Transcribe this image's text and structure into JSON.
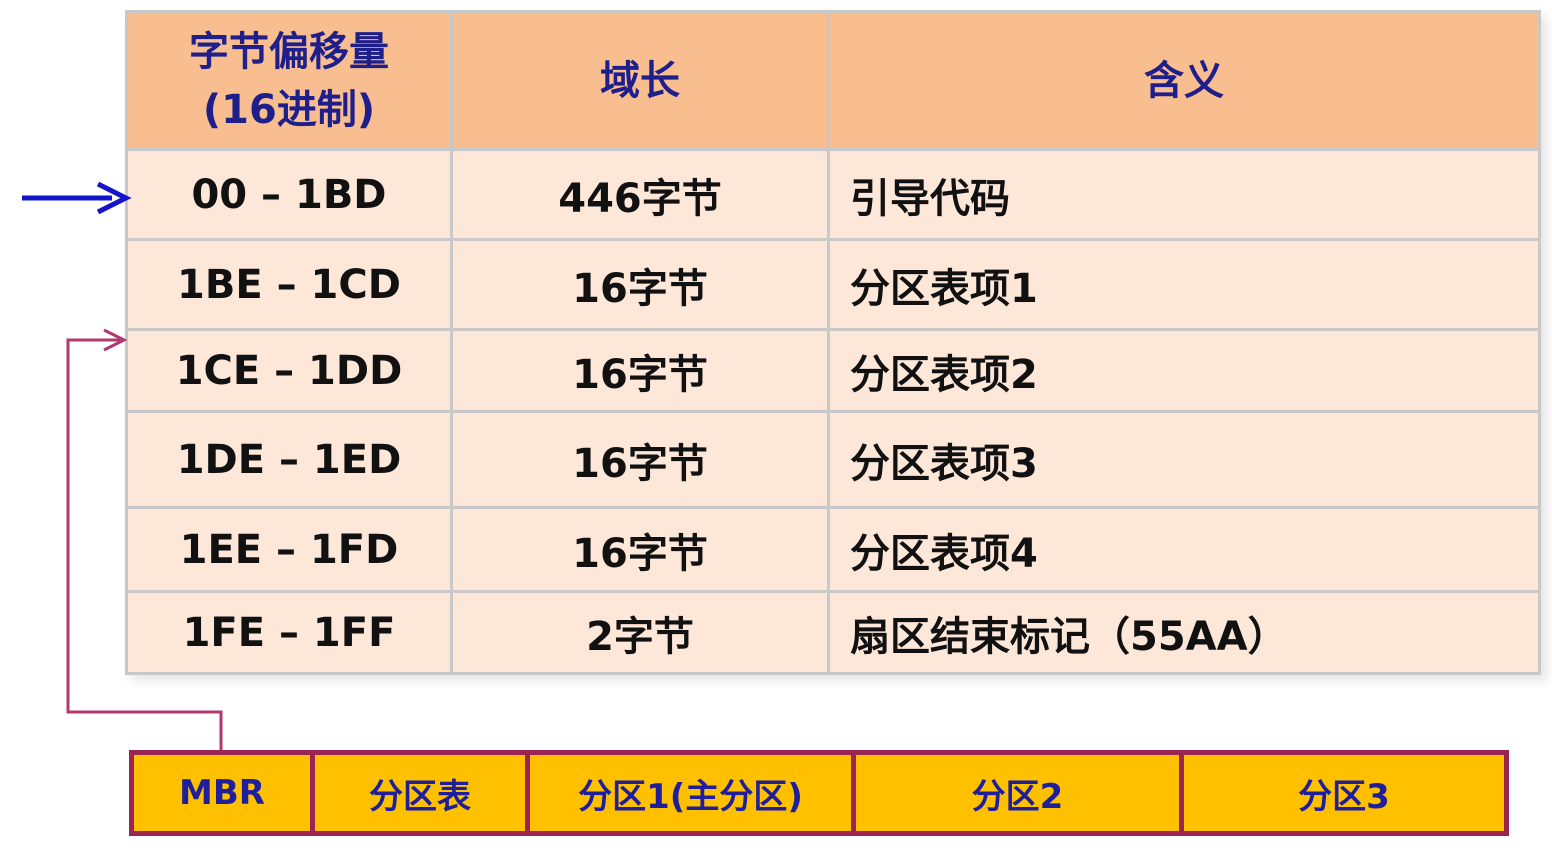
{
  "table": {
    "headers": [
      "字节偏移量\n(16进制)",
      "域长",
      "含义"
    ],
    "rows": [
      {
        "offset": "00 – 1BD",
        "length": "446字节",
        "meaning": "引导代码"
      },
      {
        "offset": "1BE – 1CD",
        "length": "16字节",
        "meaning": "分区表项1"
      },
      {
        "offset": "1CE – 1DD",
        "length": "16字节",
        "meaning": "分区表项2"
      },
      {
        "offset": "1DE – 1ED",
        "length": "16字节",
        "meaning": "分区表项3"
      },
      {
        "offset": "1EE – 1FD",
        "length": "16字节",
        "meaning": "分区表项4"
      },
      {
        "offset": "1FE – 1FF",
        "length": "2字节",
        "meaning": "扇区结束标记（55AA）"
      }
    ]
  },
  "disk_layout": {
    "cells": [
      "MBR",
      "分区表",
      "分区1(主分区)",
      "分区2",
      "分区3"
    ]
  },
  "colors": {
    "header_bg": "#f9be90",
    "row_bg": "#fde7d9",
    "header_text": "#1f1f8c",
    "bar_bg": "#ffc000",
    "bar_border": "#9b2452",
    "arrow_blue": "#1414c8",
    "connector": "#b03a6e"
  }
}
